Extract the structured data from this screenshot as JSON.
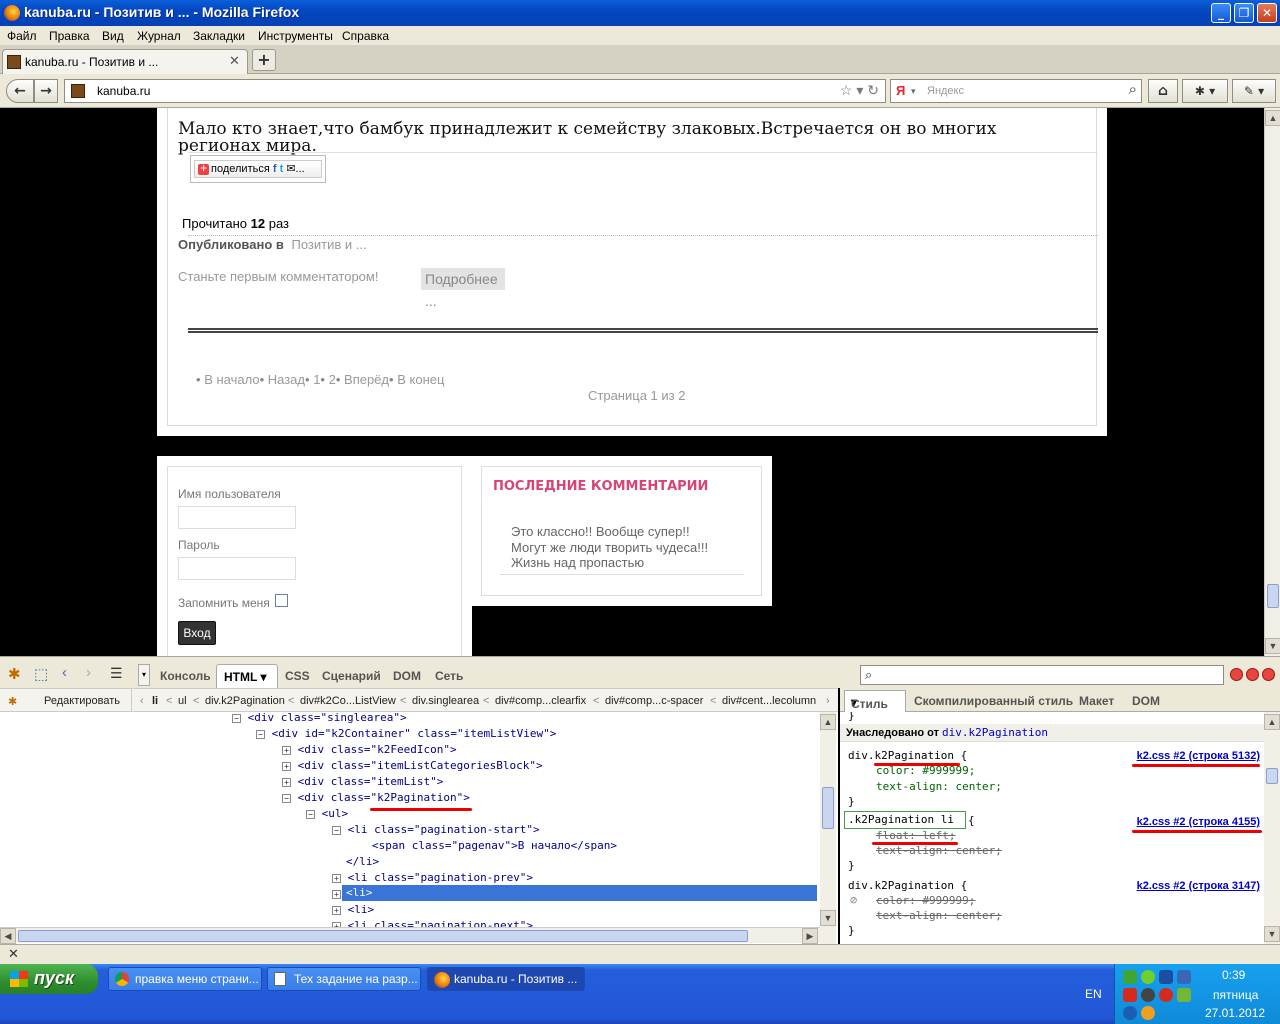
{
  "window": {
    "title": "kanuba.ru - Позитив и ... - Mozilla Firefox"
  },
  "menu": [
    "Файл",
    "Правка",
    "Вид",
    "Журнал",
    "Закладки",
    "Инструменты",
    "Справка"
  ],
  "tab": {
    "label": "kanuba.ru - Позитив и ..."
  },
  "url": "kanuba.ru",
  "search": {
    "engine": "Я",
    "placeholder": "Яндекс"
  },
  "page": {
    "article_text": "Мало кто знает,что бамбук принадлежит к семейству злаковых.Встречается он во многих регионах мира.",
    "share_label": "поделиться",
    "read_prefix": "Прочитано",
    "read_count": "12",
    "read_suffix": "раз",
    "published_label": "Опубликовано в",
    "published_category": "Позитив и ...",
    "first_comment": "Станьте первым комментатором!",
    "more_button": "Подробнее ...",
    "pagination": {
      "start": "В начало",
      "prev": "Назад",
      "p1": "1",
      "p2": "2",
      "next": "Вперёд",
      "end": "В конец"
    },
    "page_count": "Страница 1 из 2"
  },
  "login": {
    "username_label": "Имя пользователя",
    "password_label": "Пароль",
    "remember_label": "Запомнить меня",
    "submit": "Вход"
  },
  "comments": {
    "title": "ПОСЛЕДНИЕ КОММЕНТАРИИ",
    "items": [
      "Это классно!! Вообще супер!!",
      "Могут же люди творить чудеса!!!",
      "Жизнь над пропастью"
    ]
  },
  "firebug": {
    "tabs": [
      "Консоль",
      "HTML",
      "CSS",
      "Сценарий",
      "DOM",
      "Сеть"
    ],
    "edit_button": "Редактировать",
    "breadcrumbs": [
      "li",
      "ul",
      "div.k2Pagination",
      "div#k2Co...ListView",
      "div.singlearea",
      "div#comp...clearfix",
      "div#comp...c-spacer",
      "div#cent...lecolumn"
    ],
    "side_tabs": [
      "Стиль",
      "Скомпилированный стиль",
      "Макет",
      "DOM"
    ],
    "html_lines": [
      {
        "indent": "<div class=\"singlearea\">"
      },
      {
        "indent": "<div id=\"k2Container\" class=\"itemListView\">"
      },
      {
        "indent": "<div class=\"k2FeedIcon\">"
      },
      {
        "indent": "<div class=\"itemListCategoriesBlock\">"
      },
      {
        "indent": "<div class=\"itemList\">"
      },
      {
        "indent": "<div class=\"k2Pagination\">"
      },
      {
        "indent": "<ul>"
      },
      {
        "indent": "<li class=\"pagination-start\">"
      },
      {
        "indent": "<span class=\"pagenav\">В начало</span>"
      },
      {
        "indent": "</li>"
      },
      {
        "indent": "<li class=\"pagination-prev\">"
      },
      {
        "indent": "<li>"
      },
      {
        "indent": "<li>"
      },
      {
        "indent": "<li class=\"pagination-next\">"
      }
    ],
    "style": {
      "inherited_label": "Унаследовано от",
      "inherited_from": "div.k2Pagination",
      "rule1_selector": "div.k2Pagination {",
      "rule1_src": "k2.css #2 (строка 5132)",
      "rule1_color": "color: #999999;",
      "rule1_align": "text-align: center;",
      "rule2_selector": ".k2Pagination li",
      "rule2_src": "k2.css #2 (строка 4155)",
      "rule2_float": "float: left;",
      "rule2_align": "text-align: center;",
      "rule3_selector": "div.k2Pagination {",
      "rule3_src": "k2.css #2 (строка 3147)",
      "rule3_color": "color: #999999;",
      "rule3_align": "text-align: center;"
    }
  },
  "taskbar": {
    "start": "пуск",
    "items": [
      "правка меню страни...",
      "Тех задание на разр...",
      "kanuba.ru - Позитив ..."
    ],
    "lang": "EN",
    "time": "0:39",
    "day": "пятница",
    "date": "27.01.2012"
  },
  "colors": {
    "accent": "#d94477",
    "selection": "#3875d7",
    "link": "#0000cc"
  }
}
